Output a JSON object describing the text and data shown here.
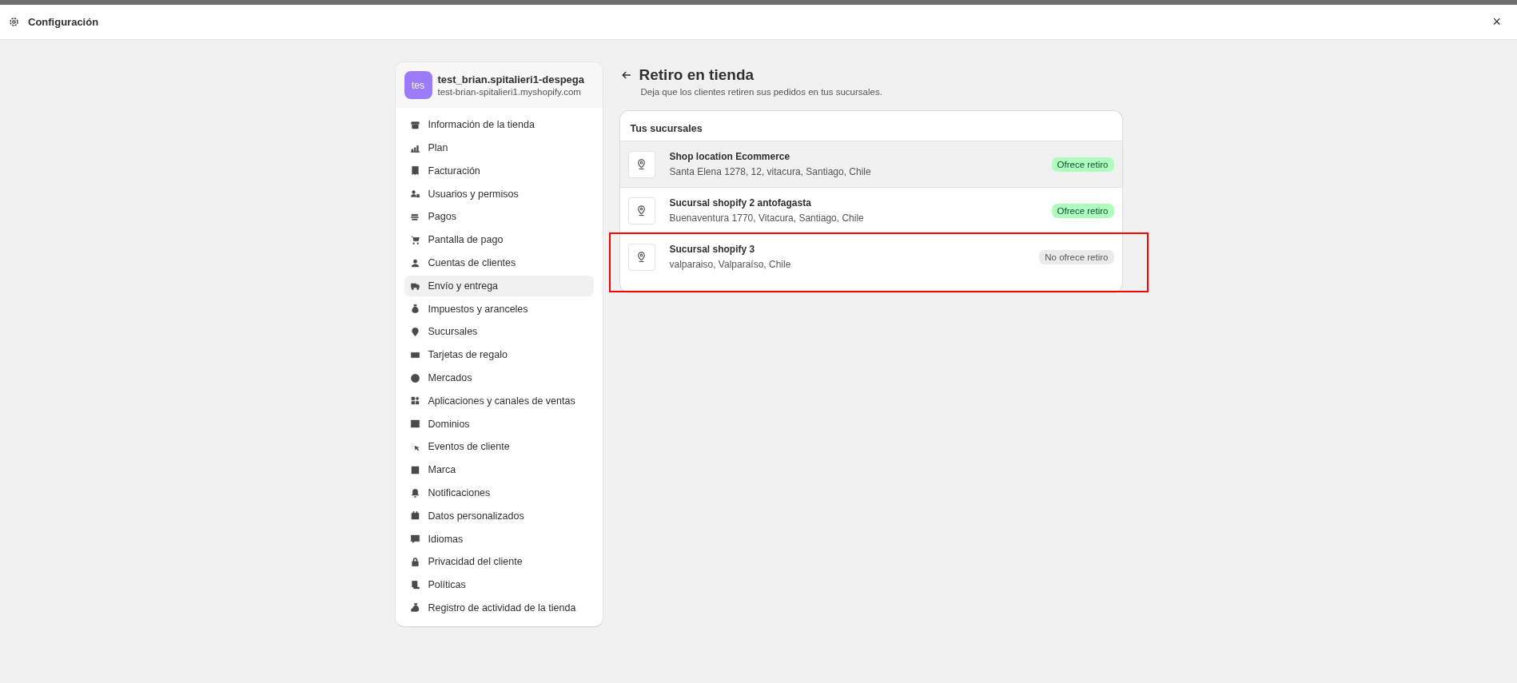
{
  "window": {
    "title": "Configuración",
    "close": "×"
  },
  "store": {
    "avatar": "tes",
    "name": "test_brian.spitalieri1-despega",
    "domain": "test-brian-spitalieri1.myshopify.com"
  },
  "sidebar": {
    "items": [
      {
        "label": "Información de la tienda",
        "selected": false
      },
      {
        "label": "Plan",
        "selected": false
      },
      {
        "label": "Facturación",
        "selected": false
      },
      {
        "label": "Usuarios y permisos",
        "selected": false
      },
      {
        "label": "Pagos",
        "selected": false
      },
      {
        "label": "Pantalla de pago",
        "selected": false
      },
      {
        "label": "Cuentas de clientes",
        "selected": false
      },
      {
        "label": "Envío y entrega",
        "selected": true
      },
      {
        "label": "Impuestos y aranceles",
        "selected": false
      },
      {
        "label": "Sucursales",
        "selected": false
      },
      {
        "label": "Tarjetas de regalo",
        "selected": false
      },
      {
        "label": "Mercados",
        "selected": false
      },
      {
        "label": "Aplicaciones y canales de ventas",
        "selected": false
      },
      {
        "label": "Dominios",
        "selected": false
      },
      {
        "label": "Eventos de cliente",
        "selected": false
      },
      {
        "label": "Marca",
        "selected": false
      },
      {
        "label": "Notificaciones",
        "selected": false
      },
      {
        "label": "Datos personalizados",
        "selected": false
      },
      {
        "label": "Idiomas",
        "selected": false
      },
      {
        "label": "Privacidad del cliente",
        "selected": false
      },
      {
        "label": "Políticas",
        "selected": false
      },
      {
        "label": "Registro de actividad de la tienda",
        "selected": false
      }
    ]
  },
  "page": {
    "title": "Retiro en tienda",
    "subtitle": "Deja que los clientes retiren sus pedidos en tus sucursales."
  },
  "locations": {
    "heading": "Tus sucursales",
    "items": [
      {
        "name": "Shop location Ecommerce",
        "address": "Santa Elena 1278, 12, vitacura, Santiago, Chile",
        "badge": "Ofrece retiro",
        "offers_pickup": true,
        "hovered": true,
        "outlined": false
      },
      {
        "name": "Sucursal shopify 2 antofagasta",
        "address": "Buenaventura 1770, Vitacura, Santiago, Chile",
        "badge": "Ofrece retiro",
        "offers_pickup": true,
        "hovered": false,
        "outlined": false
      },
      {
        "name": "Sucursal shopify 3",
        "address": "valparaiso, Valparaíso, Chile",
        "badge": "No ofrece retiro",
        "offers_pickup": false,
        "hovered": false,
        "outlined": true
      }
    ]
  }
}
